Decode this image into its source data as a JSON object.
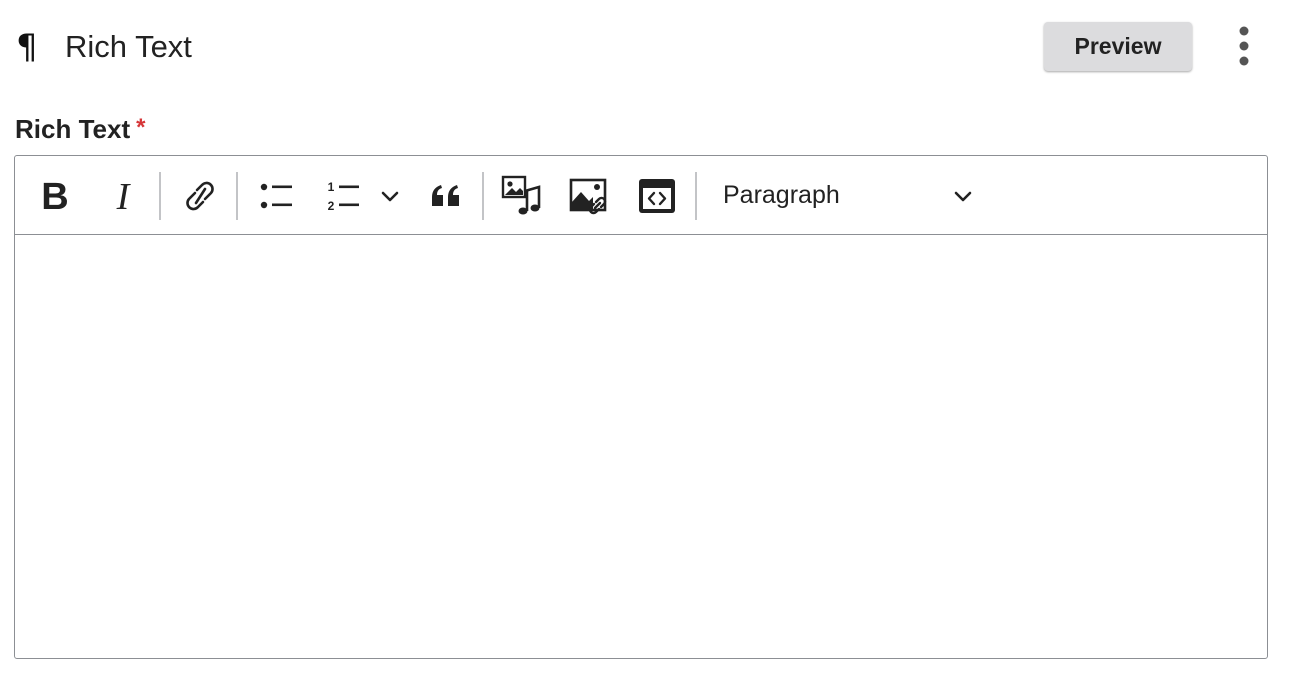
{
  "header": {
    "block_icon": "paragraph-icon",
    "block_glyph": "¶",
    "title": "Rich Text",
    "preview_label": "Preview",
    "menu_icon": "more-vertical-icon"
  },
  "field": {
    "label": "Rich Text",
    "required_marker": "*"
  },
  "toolbar": {
    "buttons": [
      {
        "name": "bold-icon"
      },
      {
        "name": "italic-icon"
      },
      {
        "name": "link-icon"
      },
      {
        "name": "bullet-list-icon"
      },
      {
        "name": "numbered-list-icon"
      },
      {
        "name": "list-dropdown-chevron-icon"
      },
      {
        "name": "blockquote-icon"
      },
      {
        "name": "media-icon"
      },
      {
        "name": "image-link-icon"
      },
      {
        "name": "embed-icon"
      }
    ],
    "format_select": {
      "value": "Paragraph",
      "chevron_icon": "chevron-down-icon"
    }
  },
  "editor": {
    "content": ""
  },
  "colors": {
    "required": "#d63638",
    "border": "#8c8f94",
    "preview_bg": "#dcdcde",
    "separator": "#c3c4c7",
    "icon": "#222222"
  }
}
